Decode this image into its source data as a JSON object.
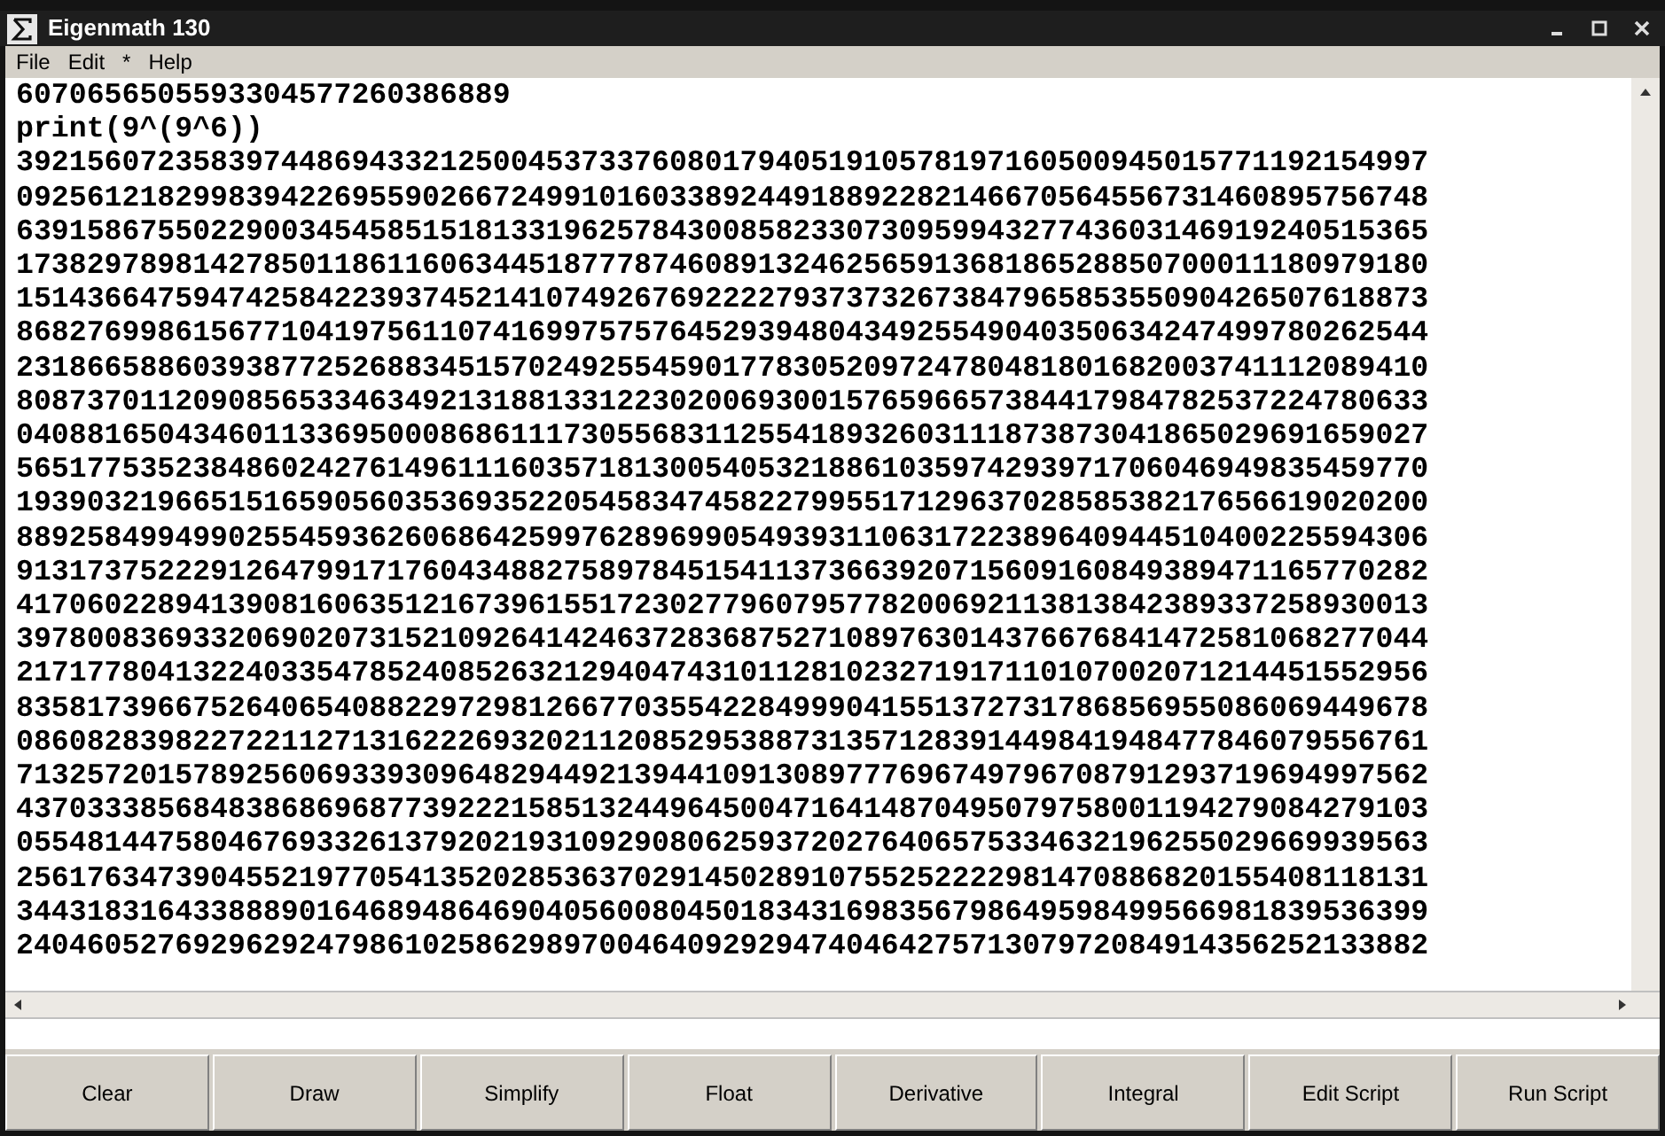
{
  "window": {
    "title": "Eigenmath 130"
  },
  "menu": [
    "File",
    "Edit",
    "*",
    "Help"
  ],
  "output": {
    "lines": [
      "6070656505593304577260386889",
      "print(9^(9^6))",
      "39215607235839744869433212500453733760801794051910578197160500945015771192154997",
      "09256121829983942269559026672499101603389244918892282146670564556731460895756748",
      "63915867550229003454585151813319625784300858233073095994327743603146919240515365",
      "17382978981427850118611606344518777874608913246256591368186528850700011180979180",
      "15143664759474258422393745214107492676922227937373267384796585355090426507618873",
      "86827699861567710419756110741699757576452939480434925549040350634247499780262544",
      "23186658860393877252688345157024925545901778305209724780481801682003741112089410",
      "80873701120908565334634921318813312230200693001576596657384417984782537224780633",
      "04088165043460113369500086861117305568311255418932603111873873041865029691659027",
      "56517753523848602427614961116035718130054053218861035974293971706046949835459770",
      "19390321966515165905603536935220545834745822799551712963702858538217656619020200",
      "88925849949902554593626068642599762896990549393110631722389640944510400225594306",
      "91317375222912647991717604348827589784515411373663920715609160849389471165770282",
      "41706022894139081606351216739615517230277960795778200692113813842389337258930013",
      "39780083693320690207315210926414246372836875271089763014376676841472581068277044",
      "21717780413224033547852408526321294047431011281023271917110107002071214451552956",
      "83581739667526406540882297298126677035542284999041551372731786856955086069449678",
      "08608283982272211271316222693202112085295388731357128391449841948477846079556761",
      "71325720157892560693393096482944921394410913089777696749796708791293719694997562",
      "43703338568483868696877392221585132449645004716414870495079758001194279084279103",
      "05548144758046769332613792021931092908062593720276406575334632196255029669939563",
      "25617634739045521977054135202853637029145028910755252222981470886820155408118131",
      "34431831643388890164689486469040560080450183431698356798649598499566981839536399",
      "24046052769296292479861025862989700464092929474046427571307972084914356252133882"
    ]
  },
  "buttons": [
    "Clear",
    "Draw",
    "Simplify",
    "Float",
    "Derivative",
    "Integral",
    "Edit Script",
    "Run Script"
  ]
}
